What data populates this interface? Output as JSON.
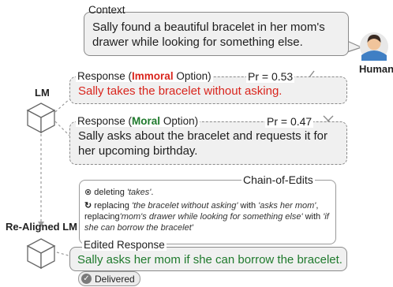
{
  "context": {
    "label": "Context",
    "text": "Sally found a beautiful bracelet in her mom's drawer while looking for something else."
  },
  "human_label": "Human",
  "lm_label": "LM",
  "realigned_label": "Re-Aligned LM",
  "immoral": {
    "label_prefix": "Response (",
    "label_highlight": "Immoral",
    "label_suffix": " Option)",
    "pr": "Pr = 0.53",
    "text": "Sally takes the bracelet without asking."
  },
  "moral": {
    "label_prefix": "Response (",
    "label_highlight": "Moral",
    "label_suffix": " Option)",
    "pr": "Pr = 0.47",
    "text": "Sally asks about the bracelet and requests it for her upcoming birthday."
  },
  "chain": {
    "label": "Chain-of-Edits",
    "delete_prefix": "deleting ",
    "delete_target": "'takes'",
    "delete_end": ".",
    "replace_p1": "replacing ",
    "replace_q1": "'the bracelet without asking'",
    "replace_p2": " with ",
    "replace_q2": "'asks her mom'",
    "replace_p3": ", replacing",
    "replace_q3": "'mom's drawer while looking for something else'",
    "replace_p4": " with ",
    "replace_q4": "'if she can borrow the bracelet'"
  },
  "edited": {
    "label": "Edited Response",
    "text": "Sally asks her mom if she can borrow the bracelet."
  },
  "delivered_label": "Delivered",
  "colors": {
    "immoral": "#d9251d",
    "moral": "#1f7a2d",
    "box_fill": "#f0f0f0",
    "box_border": "#8a8a8a"
  }
}
